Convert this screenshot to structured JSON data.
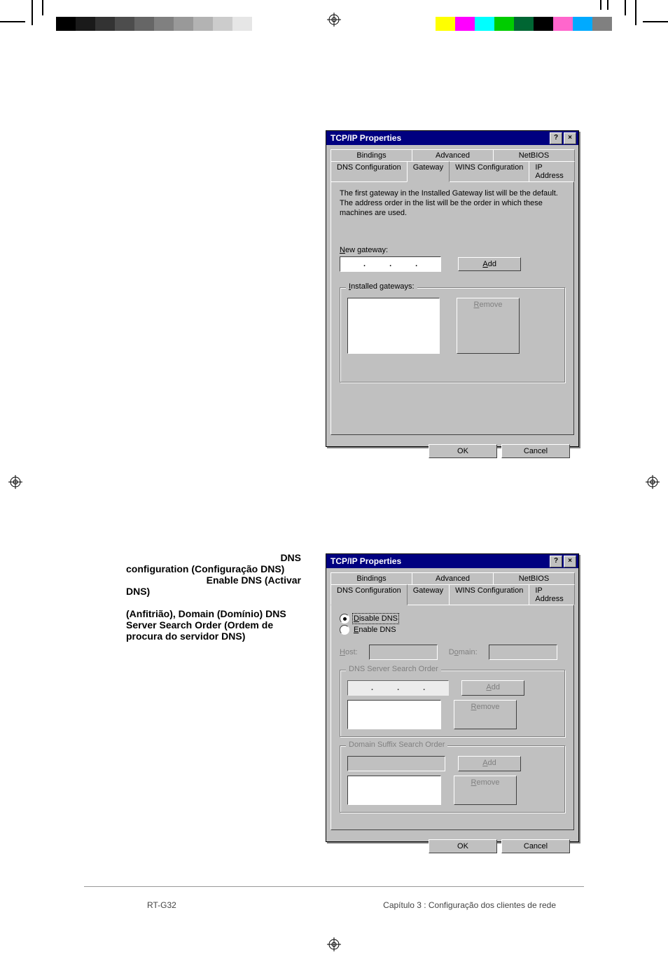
{
  "doc_text": {
    "block1_line1": "DNS",
    "block1_line2": "configuration (Configuração DNS)",
    "block1_line3": "Enable DNS (Activar",
    "block1_line4": "DNS)",
    "block2_line1": "(Anfitrião), Domain (Domínio)",
    "block2_line2": "DNS Server Search Order (Ordem",
    "block2_line3": "de procura do servidor DNS)"
  },
  "footer": {
    "left": "RT-G32",
    "right": "Capítulo 3 : Configuração dos clientes de rede"
  },
  "dialog1": {
    "title": "TCP/IP Properties",
    "help_btn": "?",
    "close_btn": "×",
    "tabs_row1": [
      "Bindings",
      "Advanced",
      "NetBIOS"
    ],
    "tabs_row2": [
      "DNS Configuration",
      "Gateway",
      "WINS Configuration",
      "IP Address"
    ],
    "active_tab": "Gateway",
    "description": "The first gateway in the Installed Gateway list will be the default. The address order in the list will be the order in which these machines are used.",
    "new_gateway_label_pre": "N",
    "new_gateway_label_rest": "ew gateway:",
    "add_btn_pre": "A",
    "add_btn_rest": "dd",
    "installed_label_pre": "I",
    "installed_label_rest": "nstalled gateways:",
    "remove_btn_pre": "R",
    "remove_btn_rest": "emove",
    "ok": "OK",
    "cancel": "Cancel"
  },
  "dialog2": {
    "title": "TCP/IP Properties",
    "help_btn": "?",
    "close_btn": "×",
    "tabs_row1": [
      "Bindings",
      "Advanced",
      "NetBIOS"
    ],
    "tabs_row2": [
      "DNS Configuration",
      "Gateway",
      "WINS Configuration",
      "IP Address"
    ],
    "active_tab": "DNS Configuration",
    "radio_disable_pre": "D",
    "radio_disable_rest": "isable DNS",
    "radio_enable_pre": "E",
    "radio_enable_rest": "nable DNS",
    "host_label_pre": "H",
    "host_label_rest": "ost:",
    "domain_label_pre": "D",
    "domain_label_mid": "o",
    "domain_label_rest": "main:",
    "dns_order_label": "DNS Server Search Order",
    "suffix_order_label": "Domain Suffix Search Order",
    "add_btn_pre": "A",
    "add_btn_rest": "dd",
    "remove_btn_pre": "R",
    "remove_btn_rest": "emove",
    "ok": "OK",
    "cancel": "Cancel"
  },
  "colorbar_left": [
    "#000",
    "#1a1a1a",
    "#333",
    "#4d4d4d",
    "#666",
    "#808080",
    "#999",
    "#b3b3b3",
    "#ccc",
    "#e6e6e6"
  ],
  "colorbar_right": [
    "#ff0",
    "#f0f",
    "#0ff",
    "#0c0",
    "#063",
    "#000",
    "#f6c",
    "#0af",
    "#808080"
  ]
}
